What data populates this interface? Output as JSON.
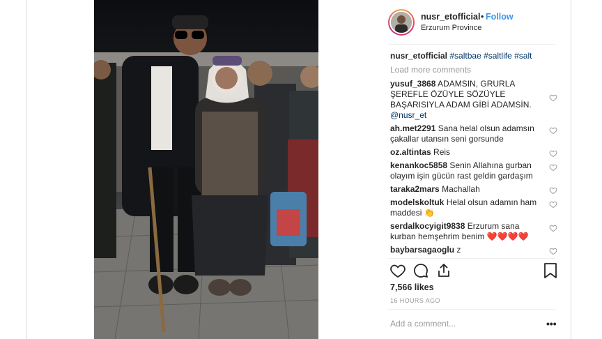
{
  "post": {
    "username": "nusr_etofficial",
    "separator": "•",
    "follow_label": "Follow",
    "location": "Erzurum Province"
  },
  "caption": {
    "username": "nusr_etofficial",
    "text": "#saltbae #saltlife #salt"
  },
  "load_more": "Load more comments",
  "comments": [
    {
      "user": "yusuf_3868",
      "text": "ADAMSIN, GRURLA ŞEREFLE ÖZÜYLE SÖZÜYLE BAŞARISIYLA ADAM GİBİ ADAMSİN.",
      "mention": "@nusr_et"
    },
    {
      "user": "ah.met2291",
      "text": "Sana helal olsun adamsın çakallar utansın seni gorsunde"
    },
    {
      "user": "oz.altintas",
      "text": "Reis"
    },
    {
      "user": "kenankoc5858",
      "text": "Senin Allahına gurban olayım işin gücün rast geldin gardaşım"
    },
    {
      "user": "taraka2mars",
      "text": "Machallah"
    },
    {
      "user": "modelskoltuk",
      "text": "Helal olsun adamın ham maddesi 👏"
    },
    {
      "user": "serdalkocyigit9838",
      "text": "Erzurum sana kurban hemşehrim benim ❤️❤️❤️❤️"
    },
    {
      "user": "baybarsagaoglu",
      "text": "z"
    }
  ],
  "icons": [
    "heart-icon",
    "comment-icon",
    "share-icon",
    "bookmark-icon"
  ],
  "likes": "7,566 likes",
  "timestamp": "16 HOURS AGO",
  "add_comment_placeholder": "Add a comment...",
  "more_options": "•••",
  "colors": {
    "link": "#3897f0",
    "hashtag": "#003569",
    "muted": "#999999",
    "text": "#262626"
  }
}
